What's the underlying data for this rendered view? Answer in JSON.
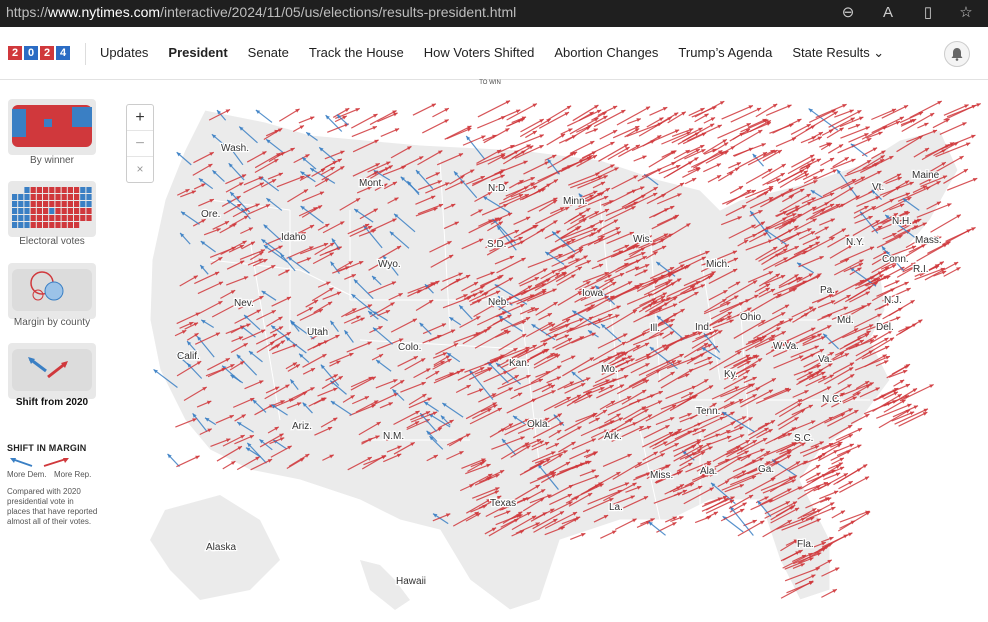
{
  "browser": {
    "url_prefix": "https://",
    "url_domain": "www.nytimes.com",
    "url_path": "/interactive/2024/11/05/us/elections/results-president.html",
    "icons": [
      "zoom-icon",
      "read-aloud-icon",
      "reader-view-icon",
      "favorite-icon"
    ]
  },
  "nav": {
    "logo_digits": [
      "2",
      "0",
      "2",
      "4"
    ],
    "items": [
      {
        "label": "Updates",
        "active": false
      },
      {
        "label": "President",
        "active": true
      },
      {
        "label": "Senate",
        "active": false
      },
      {
        "label": "Track the House",
        "active": false
      },
      {
        "label": "How Voters Shifted",
        "active": false
      },
      {
        "label": "Abortion Changes",
        "active": false
      },
      {
        "label": "Trump’s Agenda",
        "active": false
      },
      {
        "label": "State Results ⌄",
        "active": false
      }
    ]
  },
  "sidebar": {
    "views": [
      {
        "label": "By winner",
        "selected": false
      },
      {
        "label": "Electoral votes",
        "selected": false
      },
      {
        "label": "Margin by county",
        "selected": false
      },
      {
        "label": "Shift from 2020",
        "selected": true
      }
    ],
    "legend_title": "SHIFT IN MARGIN",
    "legend_dem": "More Dem.",
    "legend_rep": "More Rep.",
    "legend_note": "Compared with 2020 presidential vote in places that have reported almost all of their votes."
  },
  "map": {
    "to_win": "TO WIN",
    "zoom_in": "+",
    "zoom_out": "−",
    "reset": "×",
    "colors": {
      "rep": "#d0383c",
      "dem": "#3a7fc4",
      "land": "#ebebeb"
    },
    "state_labels": [
      "Wash.",
      "Ore.",
      "Calif.",
      "Idaho",
      "Nev.",
      "Mont.",
      "Wyo.",
      "Utah",
      "Ariz.",
      "Colo.",
      "N.M.",
      "N.D.",
      "S.D.",
      "Neb.",
      "Kan.",
      "Okla.",
      "Texas",
      "Minn.",
      "Iowa",
      "Mo.",
      "Ark.",
      "La.",
      "Wis.",
      "Ill.",
      "Mich.",
      "Ind.",
      "Ohio",
      "Ky.",
      "Tenn.",
      "Miss.",
      "Ala.",
      "Ga.",
      "Fla.",
      "S.C.",
      "N.C.",
      "Va.",
      "W.Va.",
      "Pa.",
      "N.Y.",
      "Vt.",
      "N.H.",
      "Maine",
      "Mass.",
      "Conn.",
      "R.I.",
      "N.J.",
      "Del.",
      "Md.",
      "Alaska",
      "Hawaii"
    ]
  }
}
